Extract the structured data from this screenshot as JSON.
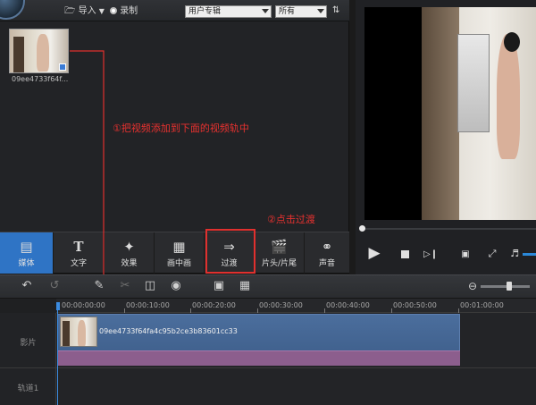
{
  "library": {
    "import_label": "导入",
    "record_label": "录制",
    "album_select": "用户专辑",
    "filter_select": "所有",
    "media_items": [
      {
        "name": "09ee4733f64f..."
      }
    ]
  },
  "tabs": [
    {
      "label": "媒体",
      "icon": "media-icon",
      "active": true
    },
    {
      "label": "文字",
      "icon": "text-icon"
    },
    {
      "label": "效果",
      "icon": "effects-icon"
    },
    {
      "label": "画中画",
      "icon": "pip-icon"
    },
    {
      "label": "过渡",
      "icon": "transition-icon"
    },
    {
      "label": "片头/片尾",
      "icon": "clapper-icon"
    },
    {
      "label": "声音",
      "icon": "headphones-icon"
    }
  ],
  "annotations": {
    "step1": "①把视频添加到下面的视频轨中",
    "step2": "②点击过渡"
  },
  "ruler": {
    "labels": [
      "00:00:00:00",
      "00:00:10:00",
      "00:00:20:00",
      "00:00:30:00",
      "00:00:40:00",
      "00:00:50:00",
      "00:01:00:00"
    ]
  },
  "tracks": {
    "video_label": "影片",
    "track1_label": "轨道1",
    "clip_name": "09ee4733f64fa4c95b2ce3b83601cc33"
  },
  "colors": {
    "accent": "#2f74c5",
    "annotation": "#e8312f",
    "clip": "#4b6e9d",
    "clip_audio": "#8c5e8d"
  }
}
